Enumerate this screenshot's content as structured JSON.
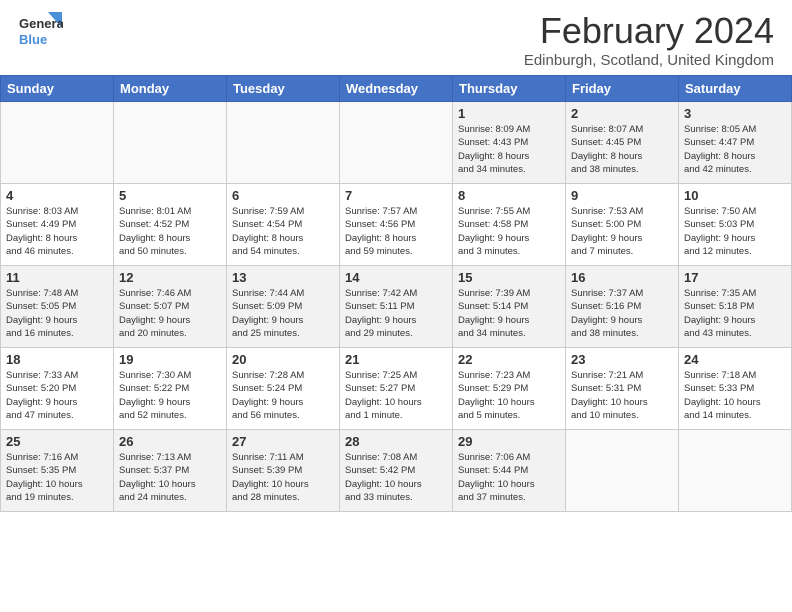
{
  "app": {
    "logo_line1": "General",
    "logo_line2": "Blue"
  },
  "header": {
    "month_year": "February 2024",
    "location": "Edinburgh, Scotland, United Kingdom"
  },
  "days_of_week": [
    "Sunday",
    "Monday",
    "Tuesday",
    "Wednesday",
    "Thursday",
    "Friday",
    "Saturday"
  ],
  "weeks": [
    {
      "days": [
        {
          "num": "",
          "info": ""
        },
        {
          "num": "",
          "info": ""
        },
        {
          "num": "",
          "info": ""
        },
        {
          "num": "",
          "info": ""
        },
        {
          "num": "1",
          "info": "Sunrise: 8:09 AM\nSunset: 4:43 PM\nDaylight: 8 hours\nand 34 minutes."
        },
        {
          "num": "2",
          "info": "Sunrise: 8:07 AM\nSunset: 4:45 PM\nDaylight: 8 hours\nand 38 minutes."
        },
        {
          "num": "3",
          "info": "Sunrise: 8:05 AM\nSunset: 4:47 PM\nDaylight: 8 hours\nand 42 minutes."
        }
      ]
    },
    {
      "days": [
        {
          "num": "4",
          "info": "Sunrise: 8:03 AM\nSunset: 4:49 PM\nDaylight: 8 hours\nand 46 minutes."
        },
        {
          "num": "5",
          "info": "Sunrise: 8:01 AM\nSunset: 4:52 PM\nDaylight: 8 hours\nand 50 minutes."
        },
        {
          "num": "6",
          "info": "Sunrise: 7:59 AM\nSunset: 4:54 PM\nDaylight: 8 hours\nand 54 minutes."
        },
        {
          "num": "7",
          "info": "Sunrise: 7:57 AM\nSunset: 4:56 PM\nDaylight: 8 hours\nand 59 minutes."
        },
        {
          "num": "8",
          "info": "Sunrise: 7:55 AM\nSunset: 4:58 PM\nDaylight: 9 hours\nand 3 minutes."
        },
        {
          "num": "9",
          "info": "Sunrise: 7:53 AM\nSunset: 5:00 PM\nDaylight: 9 hours\nand 7 minutes."
        },
        {
          "num": "10",
          "info": "Sunrise: 7:50 AM\nSunset: 5:03 PM\nDaylight: 9 hours\nand 12 minutes."
        }
      ]
    },
    {
      "days": [
        {
          "num": "11",
          "info": "Sunrise: 7:48 AM\nSunset: 5:05 PM\nDaylight: 9 hours\nand 16 minutes."
        },
        {
          "num": "12",
          "info": "Sunrise: 7:46 AM\nSunset: 5:07 PM\nDaylight: 9 hours\nand 20 minutes."
        },
        {
          "num": "13",
          "info": "Sunrise: 7:44 AM\nSunset: 5:09 PM\nDaylight: 9 hours\nand 25 minutes."
        },
        {
          "num": "14",
          "info": "Sunrise: 7:42 AM\nSunset: 5:11 PM\nDaylight: 9 hours\nand 29 minutes."
        },
        {
          "num": "15",
          "info": "Sunrise: 7:39 AM\nSunset: 5:14 PM\nDaylight: 9 hours\nand 34 minutes."
        },
        {
          "num": "16",
          "info": "Sunrise: 7:37 AM\nSunset: 5:16 PM\nDaylight: 9 hours\nand 38 minutes."
        },
        {
          "num": "17",
          "info": "Sunrise: 7:35 AM\nSunset: 5:18 PM\nDaylight: 9 hours\nand 43 minutes."
        }
      ]
    },
    {
      "days": [
        {
          "num": "18",
          "info": "Sunrise: 7:33 AM\nSunset: 5:20 PM\nDaylight: 9 hours\nand 47 minutes."
        },
        {
          "num": "19",
          "info": "Sunrise: 7:30 AM\nSunset: 5:22 PM\nDaylight: 9 hours\nand 52 minutes."
        },
        {
          "num": "20",
          "info": "Sunrise: 7:28 AM\nSunset: 5:24 PM\nDaylight: 9 hours\nand 56 minutes."
        },
        {
          "num": "21",
          "info": "Sunrise: 7:25 AM\nSunset: 5:27 PM\nDaylight: 10 hours\nand 1 minute."
        },
        {
          "num": "22",
          "info": "Sunrise: 7:23 AM\nSunset: 5:29 PM\nDaylight: 10 hours\nand 5 minutes."
        },
        {
          "num": "23",
          "info": "Sunrise: 7:21 AM\nSunset: 5:31 PM\nDaylight: 10 hours\nand 10 minutes."
        },
        {
          "num": "24",
          "info": "Sunrise: 7:18 AM\nSunset: 5:33 PM\nDaylight: 10 hours\nand 14 minutes."
        }
      ]
    },
    {
      "days": [
        {
          "num": "25",
          "info": "Sunrise: 7:16 AM\nSunset: 5:35 PM\nDaylight: 10 hours\nand 19 minutes."
        },
        {
          "num": "26",
          "info": "Sunrise: 7:13 AM\nSunset: 5:37 PM\nDaylight: 10 hours\nand 24 minutes."
        },
        {
          "num": "27",
          "info": "Sunrise: 7:11 AM\nSunset: 5:39 PM\nDaylight: 10 hours\nand 28 minutes."
        },
        {
          "num": "28",
          "info": "Sunrise: 7:08 AM\nSunset: 5:42 PM\nDaylight: 10 hours\nand 33 minutes."
        },
        {
          "num": "29",
          "info": "Sunrise: 7:06 AM\nSunset: 5:44 PM\nDaylight: 10 hours\nand 37 minutes."
        },
        {
          "num": "",
          "info": ""
        },
        {
          "num": "",
          "info": ""
        }
      ]
    }
  ]
}
